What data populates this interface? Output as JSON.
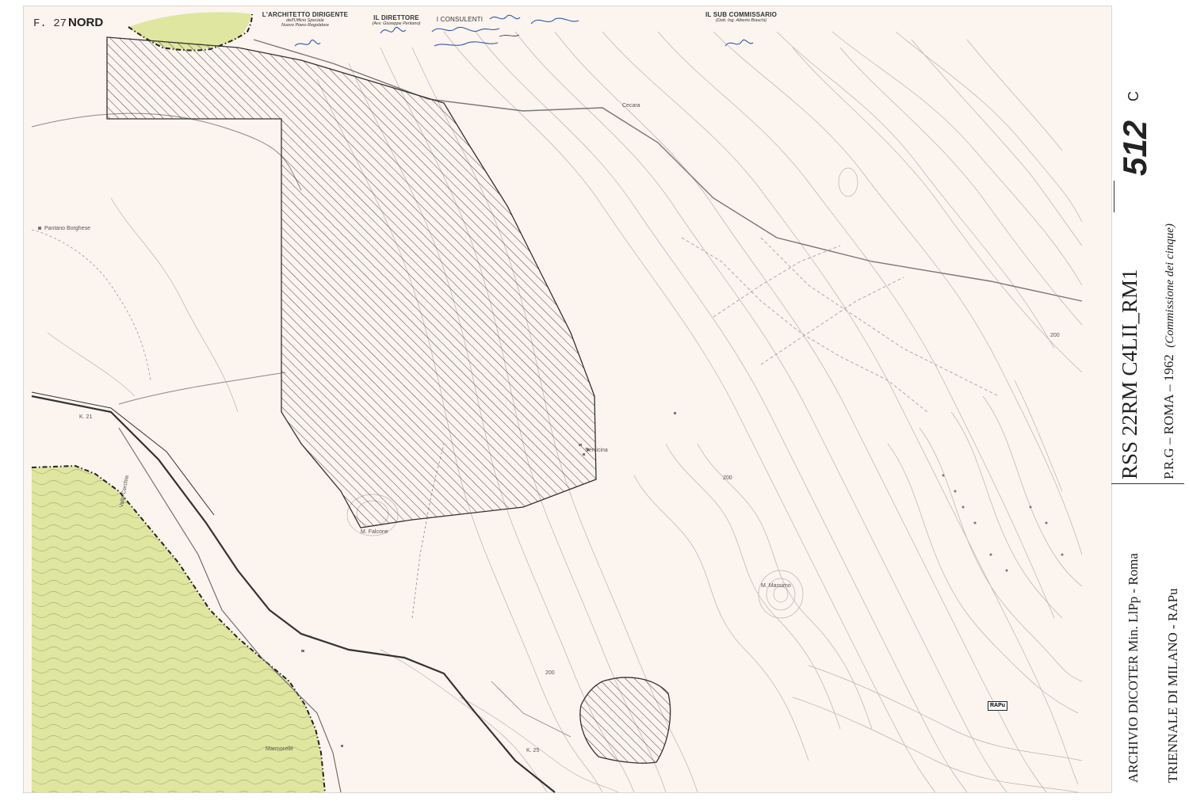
{
  "sheet": {
    "id_label": "F. 27",
    "orientation_label": "NORD"
  },
  "header": {
    "architect": {
      "title": "L'ARCHITETTO DIRIGENTE",
      "sub1": "dell'Ufficio Speciale",
      "sub2": "Nuovo Piano Regolatore"
    },
    "director": {
      "title": "IL DIRETTORE",
      "sub": "(Avv. Giuseppe Peritano)"
    },
    "consultants": {
      "title": "I CONSULENTI"
    },
    "sub_commissioner": {
      "title": "IL SUB COMMISSARIO",
      "sub": "(Dott. Ing. Alberto Biaschi)"
    }
  },
  "places": [
    {
      "id": "pantano",
      "label": "Pantano Borghese"
    },
    {
      "id": "cecara",
      "label": "Cecara"
    },
    {
      "id": "falcone",
      "label": "M. Falcone"
    },
    {
      "id": "massimo",
      "label": "M. Massimo"
    },
    {
      "id": "marmorelle",
      "label": "Marmorelle"
    },
    {
      "id": "valle",
      "label": "Valle Cerchia"
    },
    {
      "id": "servicina",
      "label": "Servicina"
    },
    {
      "id": "elev1",
      "label": "200"
    },
    {
      "id": "elev2",
      "label": "200"
    },
    {
      "id": "elev3",
      "label": "200"
    },
    {
      "id": "km21",
      "label": "K. 21"
    },
    {
      "id": "km25",
      "label": "K. 25"
    }
  ],
  "stamp": "RAPu",
  "archive": {
    "code": "RSS 22RM C4LII_RM1",
    "sheet_number": "512",
    "sheet_suffix": "C",
    "plan_line": "P.R.G – ROMA – 1962",
    "plan_note": "(Commissione dei cinque)",
    "source": "ARCHIVIO DICOTER Min. LlPp - Roma",
    "triennale": "TRIENNALE DI MILANO - RAPu"
  },
  "colors": {
    "paper": "#fbf4ef",
    "contour": "#b9b2ad",
    "hatch": "#333333",
    "green_zone": "#dfe6a0",
    "signature_ink": "#2f56a8"
  }
}
